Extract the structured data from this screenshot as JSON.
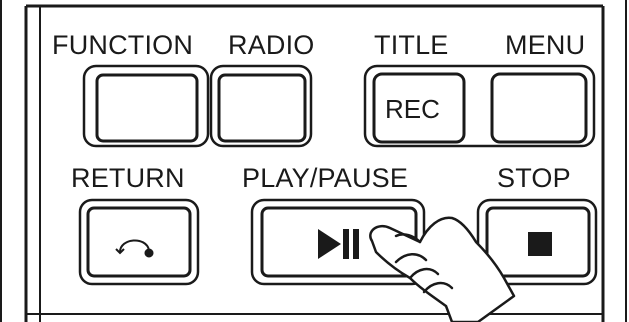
{
  "labels": {
    "function": "FUNCTION",
    "radio": "RADIO",
    "title": "TITLE",
    "menu": "MENU",
    "rec": "REC",
    "return": "RETURN",
    "play_pause": "PLAY/PAUSE",
    "stop": "STOP"
  },
  "icons": {
    "return": "return-arrow-icon",
    "play_pause": "play-pause-icon",
    "stop": "stop-square-icon",
    "hand": "pointing-hand-icon"
  },
  "colors": {
    "line": "#1a1a1a",
    "background": "#ffffff"
  }
}
